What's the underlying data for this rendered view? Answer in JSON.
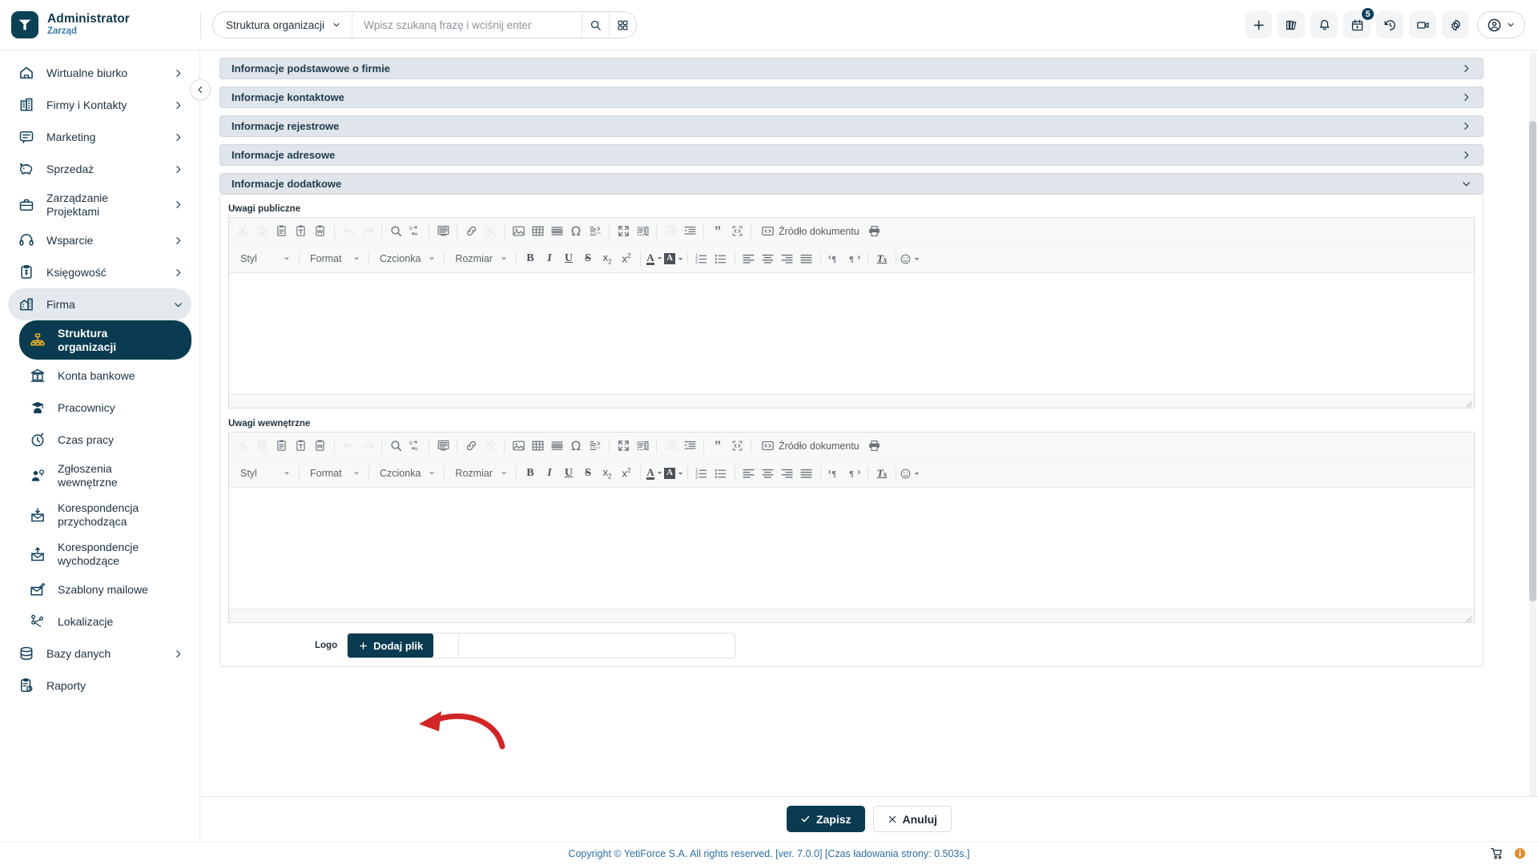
{
  "brand": {
    "name": "Administrator",
    "role": "Zarząd",
    "logo_icon": "yetiforce-y-logo"
  },
  "topbar": {
    "module_selector": {
      "label": "Struktura organizacji",
      "icon": "chevron-down-icon"
    },
    "search": {
      "placeholder": "Wpisz szukaną frazę i wciśnij enter",
      "value": ""
    },
    "search_button_icon": "search-icon",
    "grid_button_icon": "grid-apps-icon",
    "icons": [
      {
        "name": "add-icon",
        "glyph": "plus"
      },
      {
        "name": "library-icon",
        "glyph": "books"
      },
      {
        "name": "notifications-bell-icon",
        "glyph": "bell"
      },
      {
        "name": "calendar-icon",
        "glyph": "calendar",
        "badge": "5"
      },
      {
        "name": "history-icon",
        "glyph": "clock-back"
      },
      {
        "name": "video-call-icon",
        "glyph": "video"
      },
      {
        "name": "settings-gear-icon",
        "glyph": "gear"
      }
    ],
    "user_menu": {
      "avatar_icon": "user-circle-icon",
      "caret_icon": "chevron-down-icon"
    }
  },
  "sidebar": {
    "collapse_icon": "chevron-left-icon",
    "items": [
      {
        "label": "Wirtualne biurko",
        "icon": "home-icon",
        "chevron": "chevron-right-icon",
        "state": "collapsed",
        "level": 0
      },
      {
        "label": "Firmy i Kontakty",
        "icon": "building-icon",
        "chevron": "chevron-right-icon",
        "state": "collapsed",
        "level": 0
      },
      {
        "label": "Marketing",
        "icon": "chat-bubble-icon",
        "chevron": "chevron-right-icon",
        "state": "collapsed",
        "level": 0
      },
      {
        "label": "Sprzedaż",
        "icon": "piggy-bank-icon",
        "chevron": "chevron-right-icon",
        "state": "collapsed",
        "level": 0
      },
      {
        "label": "Zarządzanie Projektami",
        "icon": "briefcase-icon",
        "chevron": "chevron-right-icon",
        "state": "collapsed",
        "level": 0
      },
      {
        "label": "Wsparcie",
        "icon": "headset-icon",
        "chevron": "chevron-right-icon",
        "state": "collapsed",
        "level": 0
      },
      {
        "label": "Księgowość",
        "icon": "invoice-clipboard-icon",
        "chevron": "chevron-right-icon",
        "state": "collapsed",
        "level": 0
      },
      {
        "label": "Firma",
        "icon": "company-building-icon",
        "chevron": "chevron-down-icon",
        "state": "expanded",
        "level": 0
      },
      {
        "label": "Struktura organizacji",
        "icon": "org-chart-icon",
        "chevron": "",
        "state": "active",
        "level": 1
      },
      {
        "label": "Konta bankowe",
        "icon": "bank-icon",
        "chevron": "",
        "state": "",
        "level": 1
      },
      {
        "label": "Pracownicy",
        "icon": "graduate-user-icon",
        "chevron": "",
        "state": "",
        "level": 1
      },
      {
        "label": "Czas pracy",
        "icon": "stopwatch-icon",
        "chevron": "",
        "state": "",
        "level": 1
      },
      {
        "label": "Zgłoszenia wewnętrzne",
        "icon": "user-ticket-icon",
        "chevron": "",
        "state": "",
        "level": 1
      },
      {
        "label": "Korespondencja przychodząca",
        "icon": "mail-incoming-icon",
        "chevron": "",
        "state": "",
        "level": 1
      },
      {
        "label": "Korespondencje wychodzące",
        "icon": "mail-outgoing-icon",
        "chevron": "",
        "state": "",
        "level": 1
      },
      {
        "label": "Szablony mailowe",
        "icon": "mail-template-icon",
        "chevron": "",
        "state": "",
        "level": 1
      },
      {
        "label": "Lokalizacje",
        "icon": "locations-pins-icon",
        "chevron": "",
        "state": "",
        "level": 1
      },
      {
        "label": "Bazy danych",
        "icon": "database-icon",
        "chevron": "chevron-right-icon",
        "state": "collapsed",
        "level": 0
      },
      {
        "label": "Raporty",
        "icon": "report-clipboard-icon",
        "chevron": "",
        "state": "",
        "level": 0
      }
    ]
  },
  "main": {
    "accordions": [
      {
        "title": "Informacje podstawowe o firmie",
        "expanded": false,
        "chevron": "chevron-right-icon"
      },
      {
        "title": "Informacje kontaktowe",
        "expanded": false,
        "chevron": "chevron-right-icon"
      },
      {
        "title": "Informacje rejestrowe",
        "expanded": false,
        "chevron": "chevron-right-icon"
      },
      {
        "title": "Informacje adresowe",
        "expanded": false,
        "chevron": "chevron-right-icon"
      },
      {
        "title": "Informacje dodatkowe",
        "expanded": true,
        "chevron": "chevron-down-icon"
      }
    ],
    "fields": {
      "public_notes_label": "Uwagi publiczne",
      "internal_notes_label": "Uwagi wewnętrzne",
      "public_notes_value": "",
      "internal_notes_value": "",
      "logo_label": "Logo",
      "add_file_label": "Dodaj plik",
      "add_file_icon": "plus-icon",
      "logo_filename": ""
    },
    "editor_toolbar": {
      "row1": [
        {
          "name": "cut-icon",
          "title": "Wytnij",
          "disabled": true
        },
        {
          "name": "copy-icon",
          "title": "Kopiuj",
          "disabled": true
        },
        {
          "name": "paste-icon",
          "title": "Wklej",
          "disabled": false
        },
        {
          "name": "paste-as-text-icon",
          "title": "Wklej jako czysty tekst",
          "disabled": false
        },
        {
          "name": "paste-from-word-icon",
          "title": "Wklej z Worda",
          "disabled": false
        },
        {
          "name": "separator",
          "title": "",
          "disabled": false
        },
        {
          "name": "undo-icon",
          "title": "Cofnij",
          "disabled": true
        },
        {
          "name": "redo-icon",
          "title": "Ponów",
          "disabled": true
        },
        {
          "name": "separator",
          "title": "",
          "disabled": false
        },
        {
          "name": "find-icon",
          "title": "Znajdź",
          "disabled": false
        },
        {
          "name": "replace-icon",
          "title": "Zamień",
          "disabled": false
        },
        {
          "name": "separator",
          "title": "",
          "disabled": false
        },
        {
          "name": "select-all-icon",
          "title": "Zaznacz wszystko",
          "disabled": false
        },
        {
          "name": "separator",
          "title": "",
          "disabled": false
        },
        {
          "name": "link-icon",
          "title": "Wstaw odnośnik",
          "disabled": false
        },
        {
          "name": "unlink-icon",
          "title": "Usuń odnośnik",
          "disabled": true
        },
        {
          "name": "separator",
          "title": "",
          "disabled": false
        },
        {
          "name": "image-icon",
          "title": "Obrazek",
          "disabled": false
        },
        {
          "name": "table-icon",
          "title": "Tabela",
          "disabled": false
        },
        {
          "name": "horizontal-rule-icon",
          "title": "Wstaw poziomą linię",
          "disabled": false
        },
        {
          "name": "special-char-icon",
          "title": "Wstaw znak specjalny",
          "disabled": false
        },
        {
          "name": "page-break-icon",
          "title": "Wstaw podział strony",
          "disabled": false
        },
        {
          "name": "separator",
          "title": "",
          "disabled": false
        },
        {
          "name": "maximize-icon",
          "title": "Maksymalizuj",
          "disabled": false
        },
        {
          "name": "show-blocks-icon",
          "title": "Pokaż bloki",
          "disabled": false
        },
        {
          "name": "separator",
          "title": "",
          "disabled": false
        },
        {
          "name": "outdent-icon",
          "title": "Zmniejsz wcięcie",
          "disabled": true
        },
        {
          "name": "indent-icon",
          "title": "Zwiększ wcięcie",
          "disabled": false
        },
        {
          "name": "separator",
          "title": "",
          "disabled": false
        },
        {
          "name": "blockquote-icon",
          "title": "Cytat",
          "disabled": false
        },
        {
          "name": "div-container-icon",
          "title": "Utwórz kontener DIV",
          "disabled": false
        },
        {
          "name": "separator",
          "title": "",
          "disabled": false
        },
        {
          "name": "source-icon",
          "title": "Źródło dokumentu",
          "disabled": false
        },
        {
          "name": "print-icon",
          "title": "Drukuj",
          "disabled": false
        }
      ],
      "source_label": "Źródło dokumentu",
      "combos": [
        {
          "label": "Styl",
          "name": "style-select"
        },
        {
          "label": "Format",
          "name": "format-select"
        },
        {
          "label": "Czcionka",
          "name": "font-select"
        },
        {
          "label": "Rozmiar",
          "name": "fontsize-select"
        }
      ],
      "row2": [
        {
          "name": "bold-icon",
          "title": "Pogrubienie",
          "disabled": false
        },
        {
          "name": "italic-icon",
          "title": "Kursywa",
          "disabled": false
        },
        {
          "name": "underline-icon",
          "title": "Podkreślenie",
          "disabled": false
        },
        {
          "name": "strikethrough-icon",
          "title": "Przekreślenie",
          "disabled": false
        },
        {
          "name": "subscript-icon",
          "title": "Indeks dolny",
          "disabled": false
        },
        {
          "name": "superscript-icon",
          "title": "Indeks górny",
          "disabled": false
        },
        {
          "name": "separator",
          "title": "",
          "disabled": false
        },
        {
          "name": "text-color-icon",
          "title": "Kolor tekstu",
          "disabled": false
        },
        {
          "name": "background-color-icon",
          "title": "Kolor tła",
          "disabled": false
        },
        {
          "name": "separator",
          "title": "",
          "disabled": false
        },
        {
          "name": "numbered-list-icon",
          "title": "Lista numerowana",
          "disabled": false
        },
        {
          "name": "bulleted-list-icon",
          "title": "Lista wypunktowana",
          "disabled": false
        },
        {
          "name": "separator",
          "title": "",
          "disabled": false
        },
        {
          "name": "align-left-icon",
          "title": "Wyrównaj do lewej",
          "disabled": false
        },
        {
          "name": "align-center-icon",
          "title": "Wyśrodkuj",
          "disabled": false
        },
        {
          "name": "align-right-icon",
          "title": "Wyrównaj do prawej",
          "disabled": false
        },
        {
          "name": "align-justify-icon",
          "title": "Wyjustuj",
          "disabled": false
        },
        {
          "name": "separator",
          "title": "",
          "disabled": false
        },
        {
          "name": "text-direction-ltr-icon",
          "title": "Kierunek tekstu od lewej",
          "disabled": false
        },
        {
          "name": "text-direction-rtl-icon",
          "title": "Kierunek tekstu od prawej",
          "disabled": false
        },
        {
          "name": "separator",
          "title": "",
          "disabled": false
        },
        {
          "name": "remove-format-icon",
          "title": "Usuń formatowanie",
          "disabled": false
        },
        {
          "name": "separator",
          "title": "",
          "disabled": false
        },
        {
          "name": "smiley-icon",
          "title": "Emotikony",
          "disabled": false
        }
      ]
    },
    "actions": {
      "save_label": "Zapisz",
      "save_icon": "check-icon",
      "cancel_label": "Anuluj",
      "cancel_icon": "close-icon"
    }
  },
  "annotation": {
    "type": "red-curved-arrow",
    "color": "#d22626",
    "points_to": "Dodaj plik"
  },
  "footer": {
    "copyright": "Copyright © YetiForce S.A. All rights reserved. [ver. 7.0.0] [Czas ładowania strony: 0.503s.]",
    "icons": [
      {
        "name": "shopping-cart-icon"
      },
      {
        "name": "info-icon",
        "color": "#e08a2a"
      }
    ]
  },
  "colors": {
    "brand_dark": "#0a3b50",
    "accent_gold": "#f0b429",
    "link_blue": "#2d6fa0",
    "annotation_red": "#d22626"
  }
}
